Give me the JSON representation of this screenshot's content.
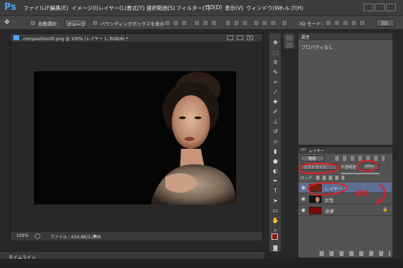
{
  "app": {
    "logo": "Ps"
  },
  "menu": [
    "ファイル(F)",
    "編集(E)",
    "イメージ(I)",
    "レイヤー(L)",
    "書式(Y)",
    "選択範囲(S)",
    "フィルター(T)",
    "3D(D)",
    "表示(V)",
    "ウィンドウ(W)",
    "ヘルプ(H)"
  ],
  "options": {
    "auto_select_label": "自動選択 :",
    "auto_select_value": "グループ",
    "bounding_box_label": "バウンディングボックスを表示",
    "mode_3d_label": "3D モード :",
    "workspace": "3D"
  },
  "document": {
    "title": "composition00.png @ 100% (レイヤー 1, RGB/8) *",
    "zoom": "100%",
    "file_info": "ファイル : 634.8K/3.24M"
  },
  "timeline": {
    "label": "タイムライン"
  },
  "properties": {
    "tab": "属性",
    "content": "プロパティなし"
  },
  "layers": {
    "tabs": [
      "3D",
      "レイヤー"
    ],
    "filter_kind": "種類",
    "blend_mode": "ソフトライト",
    "opacity_label": "不透明度 :",
    "opacity_value": "30%",
    "lock_label": "ロック :",
    "items": [
      {
        "name": "レイヤー 1"
      },
      {
        "name": "女性"
      },
      {
        "name": "背景"
      }
    ],
    "annotation": "統合"
  },
  "colors": {
    "accent": "#4aa3ff",
    "annotation": "#e02020",
    "foreground": "#8a1a10",
    "background": "#ffffff"
  }
}
